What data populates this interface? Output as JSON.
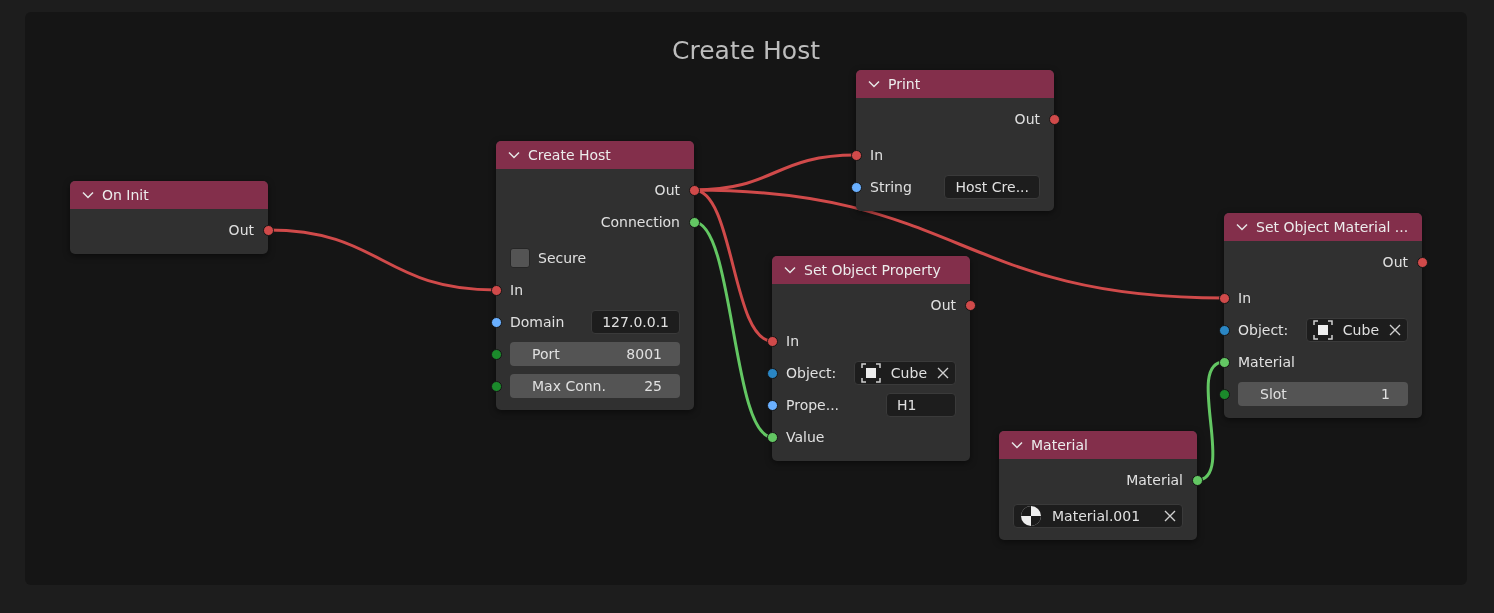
{
  "frame": {
    "title": "Create Host"
  },
  "nodes": [
    {
      "title": "On Init",
      "rows": [
        {
          "kind": "output",
          "label": "Out",
          "color": "#d04a4a"
        }
      ]
    },
    {
      "title": "Create Host",
      "rows": [
        {
          "kind": "output",
          "label": "Out",
          "color": "#d04a4a"
        },
        {
          "kind": "output",
          "label": "Connection",
          "color": "#63c763"
        },
        {
          "kind": "checkbox",
          "label": "Secure",
          "checked": false
        },
        {
          "kind": "input",
          "label": "In",
          "color": "#d04a4a"
        },
        {
          "kind": "field",
          "label": "Domain",
          "value": "127.0.0.1",
          "color": "#6ab0ff"
        },
        {
          "kind": "slider",
          "label": "Port",
          "value": "8001",
          "color": "#1b8a2b"
        },
        {
          "kind": "slider",
          "label": "Max Conn.",
          "value": "25",
          "color": "#1b8a2b"
        }
      ]
    },
    {
      "title": "Print",
      "rows": [
        {
          "kind": "output",
          "label": "Out",
          "color": "#d04a4a"
        },
        {
          "kind": "input",
          "label": "In",
          "color": "#d04a4a"
        },
        {
          "kind": "field",
          "label": "String",
          "value": "Host Cre...",
          "color": "#6ab0ff"
        }
      ]
    },
    {
      "title": "Set Object Property",
      "rows": [
        {
          "kind": "output",
          "label": "Out",
          "color": "#d04a4a"
        },
        {
          "kind": "input",
          "label": "In",
          "color": "#d04a4a"
        },
        {
          "kind": "object",
          "label": "Object:",
          "value": "Cube",
          "color": "#2a86c4"
        },
        {
          "kind": "field",
          "label": "Prope...",
          "value": "H1",
          "color": "#6ab0ff"
        },
        {
          "kind": "input",
          "label": "Value",
          "color": "#63c763"
        }
      ]
    },
    {
      "title": "Set Object Material ...",
      "rows": [
        {
          "kind": "output",
          "label": "Out",
          "color": "#d04a4a"
        },
        {
          "kind": "input",
          "label": "In",
          "color": "#d04a4a"
        },
        {
          "kind": "object",
          "label": "Object:",
          "value": "Cube",
          "color": "#2a86c4"
        },
        {
          "kind": "input",
          "label": "Material",
          "color": "#63c763"
        },
        {
          "kind": "slider",
          "label": "Slot",
          "value": "1",
          "color": "#1b8a2b"
        }
      ]
    },
    {
      "title": "Material",
      "rows": [
        {
          "kind": "output",
          "label": "Material",
          "color": "#63c763"
        },
        {
          "kind": "material",
          "value": "Material.001"
        }
      ]
    }
  ]
}
